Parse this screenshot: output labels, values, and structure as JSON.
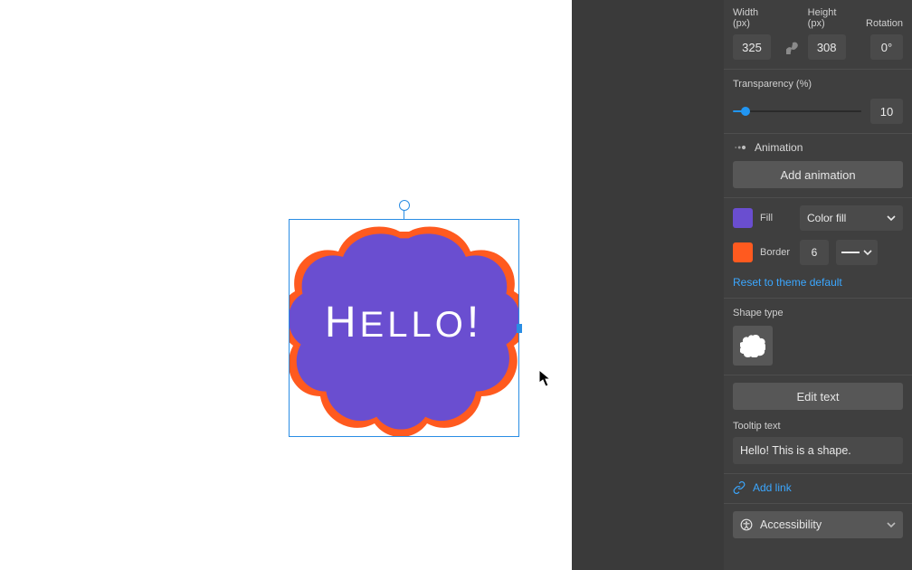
{
  "size_row": {
    "width_label": "Width (px)",
    "width_value": "325",
    "height_label": "Height (px)",
    "height_value": "308",
    "rotation_label": "Rotation",
    "rotation_value": "0°"
  },
  "transparency": {
    "label": "Transparency (%)",
    "value": "10"
  },
  "animation": {
    "heading": "Animation",
    "button": "Add animation"
  },
  "fill": {
    "label": "Fill",
    "mode": "Color fill",
    "color": "#6a4ed0"
  },
  "border": {
    "label": "Border",
    "width": "6",
    "color": "#ff5a1f"
  },
  "reset_link": "Reset to theme default",
  "shape_type": {
    "label": "Shape type"
  },
  "edit_text_btn": "Edit text",
  "tooltip": {
    "label": "Tooltip text",
    "value": "Hello! This is a shape."
  },
  "add_link": "Add link",
  "accessibility": "Accessibility",
  "canvas_shape": {
    "text": "HELLO!"
  }
}
